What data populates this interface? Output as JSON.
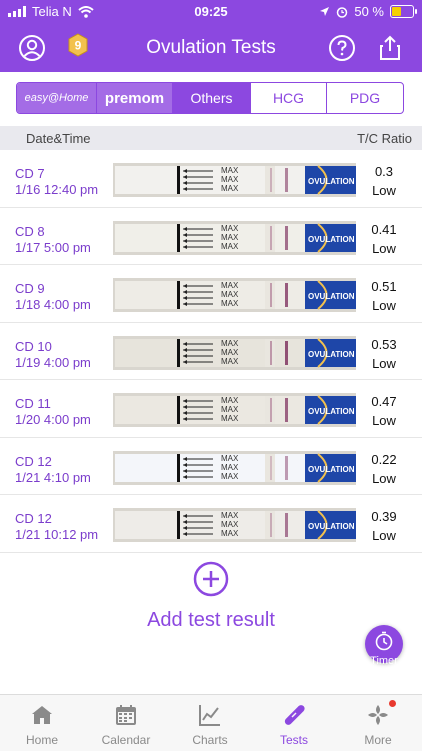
{
  "status_bar": {
    "carrier": "Telia N",
    "time": "09:25",
    "battery": "50 %",
    "battery_level": 0.5
  },
  "header": {
    "title": "Ovulation Tests",
    "level_badge": "9"
  },
  "brand_tabs": [
    "easy@Home",
    "premom",
    "Others",
    "HCG",
    "PDG"
  ],
  "active_brand_tab": "Others",
  "table": {
    "col_date": "Date&Time",
    "col_ratio": "T/C Ratio",
    "rows": [
      {
        "cd": "CD 7",
        "datetime": "1/16 12:40 pm",
        "ratio": "0.3",
        "status": "Low"
      },
      {
        "cd": "CD 8",
        "datetime": "1/17 5:00 pm",
        "ratio": "0.41",
        "status": "Low"
      },
      {
        "cd": "CD 9",
        "datetime": "1/18 4:00 pm",
        "ratio": "0.51",
        "status": "Low"
      },
      {
        "cd": "CD 10",
        "datetime": "1/19 4:00 pm",
        "ratio": "0.53",
        "status": "Low"
      },
      {
        "cd": "CD 11",
        "datetime": "1/20 4:00 pm",
        "ratio": "0.47",
        "status": "Low"
      },
      {
        "cd": "CD 12",
        "datetime": "1/21 4:10 pm",
        "ratio": "0.22",
        "status": "Low"
      },
      {
        "cd": "CD 12",
        "datetime": "1/21 10:12 pm",
        "ratio": "0.39",
        "status": "Low"
      }
    ]
  },
  "strip": {
    "max_label": "MAX",
    "brand_label": "OVULATION"
  },
  "add_result": {
    "label": "Add test result"
  },
  "timer": {
    "label": "Timer"
  },
  "tab_bar": {
    "tabs": [
      {
        "label": "Home",
        "icon": "home-icon"
      },
      {
        "label": "Calendar",
        "icon": "calendar-icon"
      },
      {
        "label": "Charts",
        "icon": "chart-icon"
      },
      {
        "label": "Tests",
        "icon": "test-strip-icon"
      },
      {
        "label": "More",
        "icon": "more-icon"
      }
    ],
    "active": "Tests"
  },
  "colors": {
    "brand": "#8c48e0",
    "tab_inactive": "#8a8a8a",
    "notification": "#e8392e"
  }
}
